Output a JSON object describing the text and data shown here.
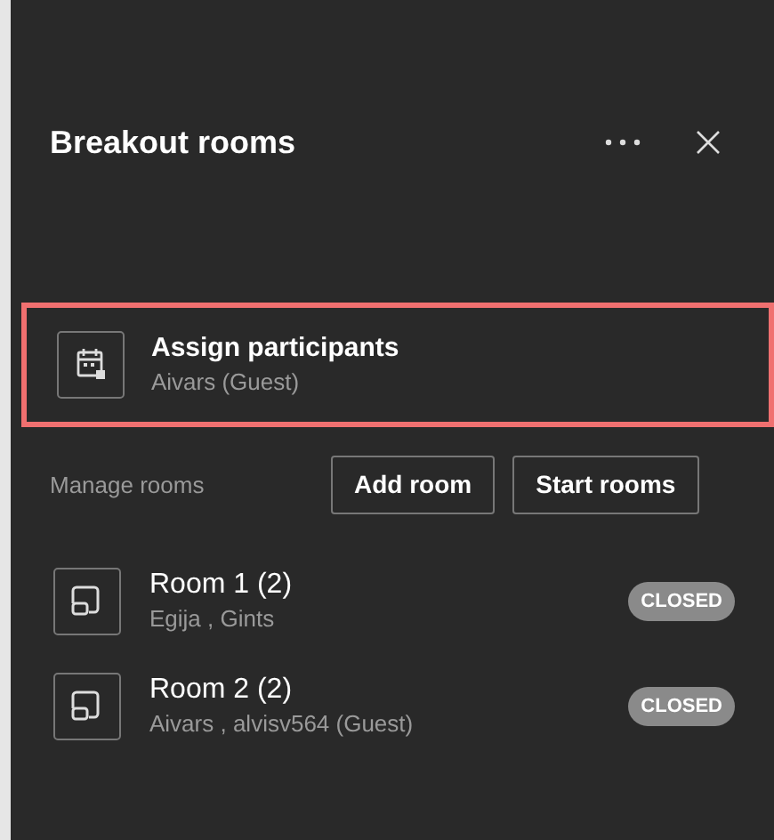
{
  "panel": {
    "title": "Breakout rooms"
  },
  "assign": {
    "title": "Assign participants",
    "subtitle": "Aivars (Guest)",
    "highlighted": true
  },
  "manage": {
    "label": "Manage rooms",
    "buttons": [
      "Add room",
      "Start rooms"
    ]
  },
  "rooms": [
    {
      "name": "Room 1 (2)",
      "participants": "Egija , Gints",
      "status": "CLOSED"
    },
    {
      "name": "Room 2 (2)",
      "participants": "Aivars , alvisv564 (Guest)",
      "status": "CLOSED"
    }
  ]
}
